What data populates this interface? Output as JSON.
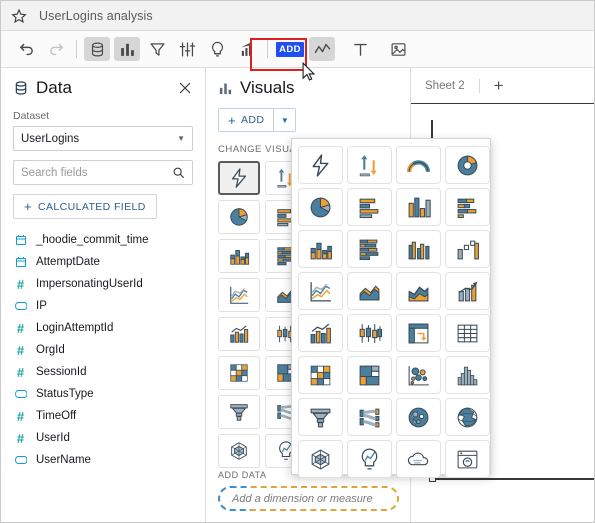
{
  "titlebar": {
    "star_icon": "star-icon",
    "title": "UserLogins analysis"
  },
  "toolbar": {
    "buttons": [
      {
        "name": "undo-button",
        "icon": "undo-icon",
        "label": "Undo",
        "state": "enabled"
      },
      {
        "name": "redo-button",
        "icon": "redo-icon",
        "label": "Redo",
        "state": "disabled"
      },
      {
        "name": "data-button",
        "icon": "database-icon",
        "label": "Data",
        "state": "active"
      },
      {
        "name": "visuals-button",
        "icon": "bar-chart-icon",
        "label": "Visuals",
        "state": "active"
      },
      {
        "name": "filter-button",
        "icon": "filter-icon",
        "label": "Filter",
        "state": "enabled"
      },
      {
        "name": "parameters-button",
        "icon": "sliders-icon",
        "label": "Parameters",
        "state": "enabled"
      },
      {
        "name": "insights-button",
        "icon": "lightbulb-icon",
        "label": "Insights",
        "state": "enabled"
      },
      {
        "name": "threshold-alerts-button",
        "icon": "trend-chart-icon",
        "label": "Threshold alerts",
        "state": "enabled"
      }
    ],
    "add_chip_label": "ADD",
    "add_visual_button": {
      "name": "add-visual-button",
      "icon": "line-chart-icon",
      "state": "active"
    },
    "text_button": {
      "name": "add-text-button",
      "icon": "text-icon",
      "label": "T"
    },
    "image_button": {
      "name": "add-image-button",
      "icon": "image-icon"
    },
    "highlight_color": "#e02020"
  },
  "data_panel": {
    "icon": "database-icon",
    "title": "Data",
    "close_label": "Close",
    "dataset_label": "Dataset",
    "dataset_value": "UserLogins",
    "search_placeholder": "Search fields",
    "calculated_field_label": "CALCULATED FIELD",
    "fields": [
      {
        "name": "_hoodie_commit_time",
        "type": "date"
      },
      {
        "name": "AttemptDate",
        "type": "date"
      },
      {
        "name": "ImpersonatingUserId",
        "type": "number"
      },
      {
        "name": "IP",
        "type": "string"
      },
      {
        "name": "LoginAttemptId",
        "type": "number"
      },
      {
        "name": "OrgId",
        "type": "number"
      },
      {
        "name": "SessionId",
        "type": "number"
      },
      {
        "name": "StatusType",
        "type": "string"
      },
      {
        "name": "TimeOff",
        "type": "number"
      },
      {
        "name": "UserId",
        "type": "number"
      },
      {
        "name": "UserName",
        "type": "string"
      }
    ]
  },
  "visuals_panel": {
    "icon": "bar-chart-icon",
    "title": "Visuals",
    "add_label": "ADD",
    "change_visual_label": "CHANGE VISUAL",
    "selected_index": 0,
    "visual_types": [
      "autograph",
      "kpi",
      "gauge",
      "donut",
      "pie",
      "horizontal-bar",
      "vertical-bar",
      "stacked-horizontal-bar",
      "stacked-vertical-bar",
      "stacked-bar-100",
      "clustered-bar",
      "waterfall",
      "line",
      "area",
      "stacked-area",
      "combo",
      "combo-bar-line",
      "box-plot",
      "pivot-table",
      "table",
      "heat-map",
      "treemap",
      "scatter-plot",
      "histogram",
      "funnel",
      "sankey",
      "points-on-map",
      "filled-map",
      "radar",
      "insight",
      "word-cloud",
      "custom-visual"
    ],
    "add_data_label": "ADD DATA",
    "drop_zone_text": "Add a dimension or measure"
  },
  "popup": {
    "name": "visual-type-picker",
    "visual_types": [
      "autograph",
      "kpi",
      "gauge",
      "donut",
      "pie",
      "horizontal-bar",
      "vertical-bar",
      "stacked-horizontal-bar",
      "stacked-vertical-bar",
      "stacked-bar-100",
      "clustered-bar",
      "waterfall",
      "line",
      "area",
      "stacked-area",
      "combo",
      "combo-bar-line",
      "box-plot",
      "pivot-table",
      "table",
      "heat-map",
      "treemap",
      "scatter-plot",
      "histogram",
      "funnel",
      "sankey",
      "points-on-map",
      "filled-map",
      "radar",
      "insight",
      "word-cloud",
      "custom-visual"
    ]
  },
  "canvas": {
    "sheet_tab_label": "Sheet 2",
    "add_sheet_label": "+"
  },
  "colors": {
    "accent_blue": "#1f4ff0",
    "link_blue": "#2a5f8f",
    "highlight_red": "#e02020",
    "chart_orange": "#f0a030",
    "chart_teal": "#4a7f9e"
  }
}
